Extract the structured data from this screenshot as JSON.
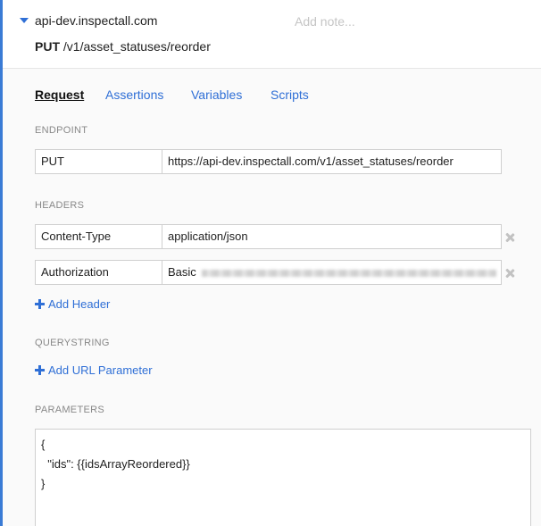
{
  "header": {
    "host": "api-dev.inspectall.com",
    "add_note_placeholder": "Add note...",
    "method": "PUT",
    "path": "/v1/asset_statuses/reorder"
  },
  "tabs": [
    {
      "label": "Request",
      "active": true
    },
    {
      "label": "Assertions",
      "active": false
    },
    {
      "label": "Variables",
      "active": false
    },
    {
      "label": "Scripts",
      "active": false
    }
  ],
  "endpoint": {
    "section_label": "ENDPOINT",
    "method": "PUT",
    "url": "https://api-dev.inspectall.com/v1/asset_statuses/reorder"
  },
  "headers": {
    "section_label": "HEADERS",
    "rows": [
      {
        "name": "Content-Type",
        "value": "application/json"
      },
      {
        "name": "Authorization",
        "value": "Basic"
      }
    ],
    "add_label": "Add Header"
  },
  "querystring": {
    "section_label": "QUERYSTRING",
    "add_label": "Add URL Parameter"
  },
  "parameters": {
    "section_label": "PARAMETERS",
    "lines": [
      "{",
      "  \"ids\": {{idsArrayReordered}}",
      "}"
    ]
  },
  "colors": {
    "accent": "#2f6fd6",
    "left_bar": "#3a7bd5"
  },
  "icons": {
    "collapse": "caret-down-icon",
    "remove": "close-icon",
    "add": "plus-icon"
  }
}
